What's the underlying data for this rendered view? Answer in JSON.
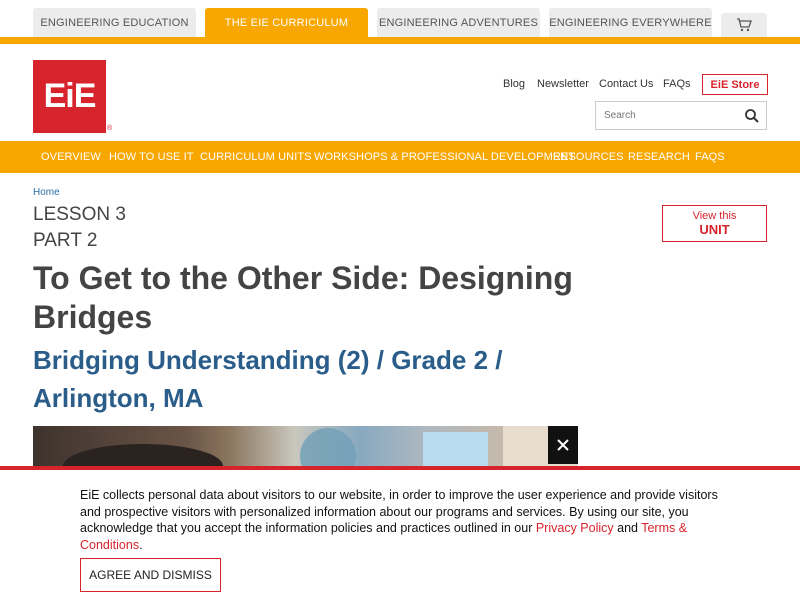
{
  "top_tabs": [
    {
      "label": "ENGINEERING EDUCATION"
    },
    {
      "label": "THE EIE CURRICULUM"
    },
    {
      "label": "ENGINEERING ADVENTURES"
    },
    {
      "label": "ENGINEERING EVERYWHERE"
    }
  ],
  "logo": {
    "text": "EiE",
    "reg": "®"
  },
  "utility": {
    "blog": "Blog",
    "newsletter": "Newsletter",
    "contact": "Contact Us",
    "faqs": "FAQs",
    "store": "EiE Store"
  },
  "search": {
    "placeholder": "Search"
  },
  "nav": [
    {
      "label": "OVERVIEW"
    },
    {
      "label": "HOW TO USE IT"
    },
    {
      "label": "CURRICULUM UNITS"
    },
    {
      "label": "WORKSHOPS & PROFESSIONAL DEVELOPMENT"
    },
    {
      "label": "RESOURCES"
    },
    {
      "label": "RESEARCH"
    },
    {
      "label": "FAQS"
    }
  ],
  "breadcrumb": "Home",
  "lesson": "LESSON 3",
  "part": "PART 2",
  "unit_button": {
    "line1": "View this",
    "line2": "UNIT"
  },
  "title": "To Get to the Other Side: Designing Bridges",
  "subtitle": "Bridging Understanding (2) / Grade 2 / Arlington, MA",
  "cookie": {
    "text_before": "EiE collects personal data about visitors to our website, in order to improve the user experience and provide visitors and prospective visitors with personalized information about our programs and services. By using our site, you acknowledge that you accept the information policies and practices outlined in our ",
    "privacy": "Privacy Policy",
    "and": " and ",
    "terms": "Terms & Conditions",
    "period": ".",
    "agree": "AGREE AND DISMISS"
  },
  "colors": {
    "accent": "#f7a700",
    "brand_red": "#d7242c"
  }
}
